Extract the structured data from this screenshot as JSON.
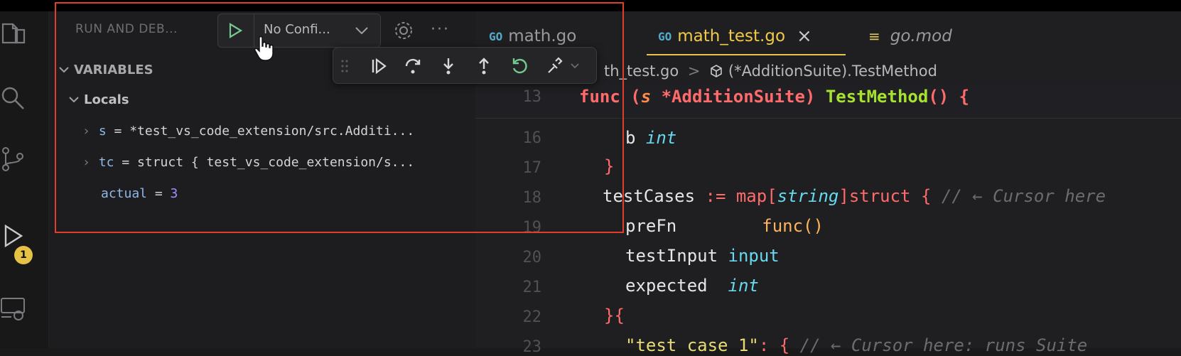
{
  "sidebar": {
    "view_title": "RUN AND DEB...",
    "launch_config": "No Confi...",
    "more_label": "···",
    "sections": {
      "variables": "VARIABLES",
      "locals": "Locals"
    },
    "variables": [
      {
        "name": "s",
        "eq": " = ",
        "value": "*test_vs_code_extension/src.Additi..."
      },
      {
        "name": "tc",
        "eq": " = ",
        "value": "struct { test_vs_code_extension/s..."
      },
      {
        "name": "actual",
        "eq": " = ",
        "value": "3"
      }
    ]
  },
  "activity_bar": {
    "badge_count": "1",
    "icons": [
      "explorer-icon",
      "search-icon",
      "source-control-icon",
      "run-debug-icon",
      "remote-explorer-icon"
    ]
  },
  "debug_toolbar": {
    "buttons": [
      "drag-handle-icon",
      "continue-icon",
      "step-over-icon",
      "step-into-icon",
      "step-out-icon",
      "restart-icon",
      "disconnect-icon"
    ]
  },
  "tabs": [
    {
      "badge": "GO",
      "label": "math.go",
      "active": false
    },
    {
      "badge": "GO",
      "label": "math_test.go",
      "active": true,
      "close": "×"
    },
    {
      "badge": "≡",
      "label": "go.mod",
      "active": false
    }
  ],
  "breadcrumb": {
    "file": "th_test.go",
    "sep": ">",
    "symbol": "(*AdditionSuite).TestMethod"
  },
  "editor": {
    "lines": [
      "13",
      "16",
      "17",
      "18",
      "19",
      "20",
      "21",
      "22",
      "23"
    ],
    "sticky": {
      "func": "func",
      "rest_a": " (",
      "recv": "s",
      "recv_type": " *AdditionSuite",
      "rest_b": ") ",
      "fn": "TestMethod",
      "paren": "()",
      "brace": " {"
    },
    "l16": {
      "name": "b ",
      "type": "int"
    },
    "l17": "}",
    "l18": {
      "name": "testCases",
      "op": " := ",
      "map": "map",
      "lb": "[",
      "key": "string",
      "rb": "]",
      "st": "struct",
      "brace": " { ",
      "comment": "// ← Cursor here"
    },
    "l19": {
      "name": "preFn",
      "type": "func()"
    },
    "l20": {
      "name": "testInput ",
      "type": "input"
    },
    "l21": {
      "name": "expected  ",
      "type": "int"
    },
    "l22": {
      "a": "}",
      "b": "{"
    },
    "l23": {
      "str": "\"test case 1\"",
      "colon": ": ",
      "brace": "{ ",
      "comment": "// ← Cursor here: runs Suite"
    }
  },
  "colors": {
    "highlight_box": "#e0402a",
    "active_tab_underline": "#e8c547",
    "badge": "#e5c145",
    "play": "#73c991"
  }
}
